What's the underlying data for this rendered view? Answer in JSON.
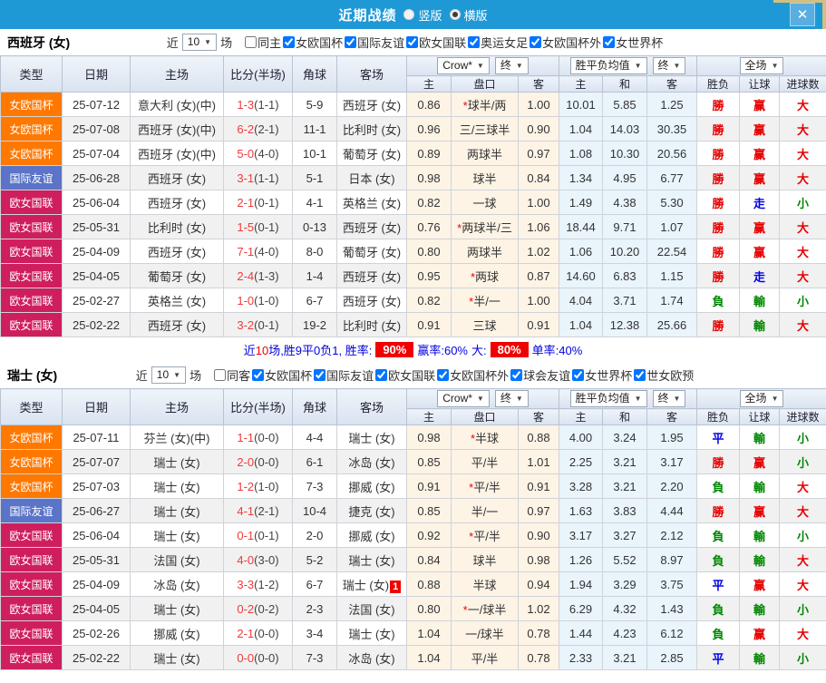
{
  "titlebar": {
    "title": "近期战绩",
    "radio_options": [
      {
        "label": "竖版",
        "selected": false
      },
      {
        "label": "横版",
        "selected": true
      }
    ],
    "close_label": "✕"
  },
  "colors": {
    "accent_blue": "#1f99d6",
    "team_green": "#008000",
    "score_red": "#ef3a3a",
    "summary_blue": "#0000e0",
    "highlight_red": "#f00000",
    "type_colors": {
      "女欧国杯": "#ff7800",
      "国际友谊": "#5b74c8",
      "欧女国联": "#cf1e5e"
    },
    "result_colors": {
      "勝": "#e60000",
      "負": "#008800",
      "平": "#0000e6",
      "赢": "#e60000",
      "輸": "#008800",
      "走": "#0000e6",
      "大": "#e60000",
      "小": "#008800"
    }
  },
  "sections": [
    {
      "team_title": "西班牙 (女)",
      "filter": {
        "recent_label": "近",
        "recent_value": "10",
        "matches_label": "场",
        "same_side_label": "同主",
        "same_side_checked": false,
        "competitions": [
          "女欧国杯",
          "国际友谊",
          "欧女国联",
          "奥运女足",
          "女欧国杯外",
          "女世界杯"
        ]
      },
      "header": {
        "base_cols": [
          "类型",
          "日期",
          "主场",
          "比分(半场)",
          "角球",
          "客场"
        ],
        "odds_source": "Crow*",
        "odds_time": "终",
        "avg_label": "胜平负均值",
        "avg_time": "终",
        "scope": "全场",
        "sub_cols": [
          "主",
          "盘口",
          "客",
          "主",
          "和",
          "客",
          "胜负",
          "让球",
          "进球数"
        ]
      },
      "rows": [
        {
          "type": "女欧国杯",
          "date": "25-07-12",
          "home": "意大利 (女)(中)",
          "home_green": false,
          "ft": "1-3",
          "ht": "(1-1)",
          "corner": "5-9",
          "away": "西班牙 (女)",
          "away_green": true,
          "away_badge": "",
          "o_home": "0.86",
          "star": true,
          "line": "球半/两",
          "o_away": "1.00",
          "avg_h": "10.01",
          "avg_d": "5.85",
          "avg_a": "1.25",
          "res": "勝",
          "hand": "赢",
          "goal": "大"
        },
        {
          "type": "女欧国杯",
          "date": "25-07-08",
          "home": "西班牙 (女)(中)",
          "home_green": true,
          "ft": "6-2",
          "ht": "(2-1)",
          "corner": "11-1",
          "away": "比利时 (女)",
          "away_green": false,
          "away_badge": "",
          "o_home": "0.96",
          "star": false,
          "line": "三/三球半",
          "o_away": "0.90",
          "avg_h": "1.04",
          "avg_d": "14.03",
          "avg_a": "30.35",
          "res": "勝",
          "hand": "赢",
          "goal": "大"
        },
        {
          "type": "女欧国杯",
          "date": "25-07-04",
          "home": "西班牙 (女)(中)",
          "home_green": true,
          "ft": "5-0",
          "ht": "(4-0)",
          "corner": "10-1",
          "away": "葡萄牙 (女)",
          "away_green": false,
          "away_badge": "",
          "o_home": "0.89",
          "star": false,
          "line": "两球半",
          "o_away": "0.97",
          "avg_h": "1.08",
          "avg_d": "10.30",
          "avg_a": "20.56",
          "res": "勝",
          "hand": "赢",
          "goal": "大"
        },
        {
          "type": "国际友谊",
          "date": "25-06-28",
          "home": "西班牙 (女)",
          "home_green": true,
          "ft": "3-1",
          "ht": "(1-1)",
          "corner": "5-1",
          "away": "日本 (女)",
          "away_green": false,
          "away_badge": "",
          "o_home": "0.98",
          "star": false,
          "line": "球半",
          "o_away": "0.84",
          "avg_h": "1.34",
          "avg_d": "4.95",
          "avg_a": "6.77",
          "res": "勝",
          "hand": "赢",
          "goal": "大"
        },
        {
          "type": "欧女国联",
          "date": "25-06-04",
          "home": "西班牙 (女)",
          "home_green": true,
          "ft": "2-1",
          "ht": "(0-1)",
          "corner": "4-1",
          "away": "英格兰 (女)",
          "away_green": false,
          "away_badge": "",
          "o_home": "0.82",
          "star": false,
          "line": "一球",
          "o_away": "1.00",
          "avg_h": "1.49",
          "avg_d": "4.38",
          "avg_a": "5.30",
          "res": "勝",
          "hand": "走",
          "goal": "小"
        },
        {
          "type": "欧女国联",
          "date": "25-05-31",
          "home": "比利时 (女)",
          "home_green": false,
          "ft": "1-5",
          "ht": "(0-1)",
          "corner": "0-13",
          "away": "西班牙 (女)",
          "away_green": true,
          "away_badge": "",
          "o_home": "0.76",
          "star": true,
          "line": "两球半/三",
          "o_away": "1.06",
          "avg_h": "18.44",
          "avg_d": "9.71",
          "avg_a": "1.07",
          "res": "勝",
          "hand": "赢",
          "goal": "大"
        },
        {
          "type": "欧女国联",
          "date": "25-04-09",
          "home": "西班牙 (女)",
          "home_green": true,
          "ft": "7-1",
          "ht": "(4-0)",
          "corner": "8-0",
          "away": "葡萄牙 (女)",
          "away_green": false,
          "away_badge": "",
          "o_home": "0.80",
          "star": false,
          "line": "两球半",
          "o_away": "1.02",
          "avg_h": "1.06",
          "avg_d": "10.20",
          "avg_a": "22.54",
          "res": "勝",
          "hand": "赢",
          "goal": "大"
        },
        {
          "type": "欧女国联",
          "date": "25-04-05",
          "home": "葡萄牙 (女)",
          "home_green": false,
          "ft": "2-4",
          "ht": "(1-3)",
          "corner": "1-4",
          "away": "西班牙 (女)",
          "away_green": true,
          "away_badge": "",
          "o_home": "0.95",
          "star": true,
          "line": "两球",
          "o_away": "0.87",
          "avg_h": "14.60",
          "avg_d": "6.83",
          "avg_a": "1.15",
          "res": "勝",
          "hand": "走",
          "goal": "大"
        },
        {
          "type": "欧女国联",
          "date": "25-02-27",
          "home": "英格兰 (女)",
          "home_green": false,
          "ft": "1-0",
          "ht": "(1-0)",
          "corner": "6-7",
          "away": "西班牙 (女)",
          "away_green": true,
          "away_badge": "",
          "o_home": "0.82",
          "star": true,
          "line": "半/一",
          "o_away": "1.00",
          "avg_h": "4.04",
          "avg_d": "3.71",
          "avg_a": "1.74",
          "res": "負",
          "hand": "輸",
          "goal": "小"
        },
        {
          "type": "欧女国联",
          "date": "25-02-22",
          "home": "西班牙 (女)",
          "home_green": true,
          "ft": "3-2",
          "ht": "(0-1)",
          "corner": "19-2",
          "away": "比利时 (女)",
          "away_green": false,
          "away_badge": "",
          "o_home": "0.91",
          "star": false,
          "line": "三球",
          "o_away": "0.91",
          "avg_h": "1.04",
          "avg_d": "12.38",
          "avg_a": "25.66",
          "res": "勝",
          "hand": "輸",
          "goal": "大"
        }
      ],
      "summary": {
        "pre": "近",
        "count": "10",
        "text1": "场,胜9平0负1, 胜率:",
        "win_rate": "90%",
        "text2": "赢率:60%",
        "text3": "大:",
        "big_rate": "80%",
        "text4": "单率:40%"
      }
    },
    {
      "team_title": "瑞士 (女)",
      "filter": {
        "recent_label": "近",
        "recent_value": "10",
        "matches_label": "场",
        "same_side_label": "同客",
        "same_side_checked": false,
        "competitions": [
          "女欧国杯",
          "国际友谊",
          "欧女国联",
          "女欧国杯外",
          "球会友谊",
          "女世界杯",
          "世女欧预"
        ]
      },
      "header": {
        "base_cols": [
          "类型",
          "日期",
          "主场",
          "比分(半场)",
          "角球",
          "客场"
        ],
        "odds_source": "Crow*",
        "odds_time": "终",
        "avg_label": "胜平负均值",
        "avg_time": "终",
        "scope": "全场",
        "sub_cols": [
          "主",
          "盘口",
          "客",
          "主",
          "和",
          "客",
          "胜负",
          "让球",
          "进球数"
        ]
      },
      "rows": [
        {
          "type": "女欧国杯",
          "date": "25-07-11",
          "home": "芬兰 (女)(中)",
          "home_green": false,
          "ft": "1-1",
          "ht": "(0-0)",
          "corner": "4-4",
          "away": "瑞士 (女)",
          "away_green": true,
          "away_badge": "",
          "o_home": "0.98",
          "star": true,
          "line": "半球",
          "o_away": "0.88",
          "avg_h": "4.00",
          "avg_d": "3.24",
          "avg_a": "1.95",
          "res": "平",
          "hand": "輸",
          "goal": "小"
        },
        {
          "type": "女欧国杯",
          "date": "25-07-07",
          "home": "瑞士 (女)",
          "home_green": true,
          "ft": "2-0",
          "ht": "(0-0)",
          "corner": "6-1",
          "away": "冰岛 (女)",
          "away_green": false,
          "away_badge": "",
          "o_home": "0.85",
          "star": false,
          "line": "平/半",
          "o_away": "1.01",
          "avg_h": "2.25",
          "avg_d": "3.21",
          "avg_a": "3.17",
          "res": "勝",
          "hand": "赢",
          "goal": "小"
        },
        {
          "type": "女欧国杯",
          "date": "25-07-03",
          "home": "瑞士 (女)",
          "home_green": true,
          "ft": "1-2",
          "ht": "(1-0)",
          "corner": "7-3",
          "away": "挪威 (女)",
          "away_green": false,
          "away_badge": "",
          "o_home": "0.91",
          "star": true,
          "line": "平/半",
          "o_away": "0.91",
          "avg_h": "3.28",
          "avg_d": "3.21",
          "avg_a": "2.20",
          "res": "負",
          "hand": "輸",
          "goal": "大"
        },
        {
          "type": "国际友谊",
          "date": "25-06-27",
          "home": "瑞士 (女)",
          "home_green": true,
          "ft": "4-1",
          "ht": "(2-1)",
          "corner": "10-4",
          "away": "捷克 (女)",
          "away_green": false,
          "away_badge": "",
          "o_home": "0.85",
          "star": false,
          "line": "半/一",
          "o_away": "0.97",
          "avg_h": "1.63",
          "avg_d": "3.83",
          "avg_a": "4.44",
          "res": "勝",
          "hand": "赢",
          "goal": "大"
        },
        {
          "type": "欧女国联",
          "date": "25-06-04",
          "home": "瑞士 (女)",
          "home_green": true,
          "ft": "0-1",
          "ht": "(0-1)",
          "corner": "2-0",
          "away": "挪威 (女)",
          "away_green": false,
          "away_badge": "",
          "o_home": "0.92",
          "star": true,
          "line": "平/半",
          "o_away": "0.90",
          "avg_h": "3.17",
          "avg_d": "3.27",
          "avg_a": "2.12",
          "res": "負",
          "hand": "輸",
          "goal": "小"
        },
        {
          "type": "欧女国联",
          "date": "25-05-31",
          "home": "法国 (女)",
          "home_green": false,
          "ft": "4-0",
          "ht": "(3-0)",
          "corner": "5-2",
          "away": "瑞士 (女)",
          "away_green": true,
          "away_badge": "",
          "o_home": "0.84",
          "star": false,
          "line": "球半",
          "o_away": "0.98",
          "avg_h": "1.26",
          "avg_d": "5.52",
          "avg_a": "8.97",
          "res": "負",
          "hand": "輸",
          "goal": "大"
        },
        {
          "type": "欧女国联",
          "date": "25-04-09",
          "home": "冰岛 (女)",
          "home_green": false,
          "ft": "3-3",
          "ht": "(1-2)",
          "corner": "6-7",
          "away": "瑞士 (女)",
          "away_green": true,
          "away_badge": "1",
          "o_home": "0.88",
          "star": false,
          "line": "半球",
          "o_away": "0.94",
          "avg_h": "1.94",
          "avg_d": "3.29",
          "avg_a": "3.75",
          "res": "平",
          "hand": "赢",
          "goal": "大"
        },
        {
          "type": "欧女国联",
          "date": "25-04-05",
          "home": "瑞士 (女)",
          "home_green": true,
          "ft": "0-2",
          "ht": "(0-2)",
          "corner": "2-3",
          "away": "法国 (女)",
          "away_green": false,
          "away_badge": "",
          "o_home": "0.80",
          "star": true,
          "line": "一/球半",
          "o_away": "1.02",
          "avg_h": "6.29",
          "avg_d": "4.32",
          "avg_a": "1.43",
          "res": "負",
          "hand": "輸",
          "goal": "小"
        },
        {
          "type": "欧女国联",
          "date": "25-02-26",
          "home": "挪威 (女)",
          "home_green": false,
          "ft": "2-1",
          "ht": "(0-0)",
          "corner": "3-4",
          "away": "瑞士 (女)",
          "away_green": true,
          "away_badge": "",
          "o_home": "1.04",
          "star": false,
          "line": "一/球半",
          "o_away": "0.78",
          "avg_h": "1.44",
          "avg_d": "4.23",
          "avg_a": "6.12",
          "res": "負",
          "hand": "赢",
          "goal": "大"
        },
        {
          "type": "欧女国联",
          "date": "25-02-22",
          "home": "瑞士 (女)",
          "home_green": true,
          "ft": "0-0",
          "ht": "(0-0)",
          "corner": "7-3",
          "away": "冰岛 (女)",
          "away_green": false,
          "away_badge": "",
          "o_home": "1.04",
          "star": false,
          "line": "平/半",
          "o_away": "0.78",
          "avg_h": "2.33",
          "avg_d": "3.21",
          "avg_a": "2.85",
          "res": "平",
          "hand": "輸",
          "goal": "小"
        }
      ],
      "summary": null
    }
  ]
}
